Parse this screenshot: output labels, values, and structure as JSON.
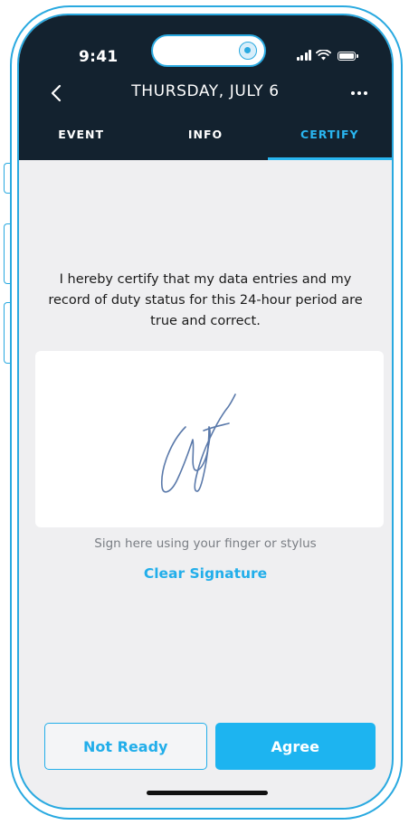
{
  "status_bar": {
    "time": "9:41"
  },
  "header": {
    "back_icon": "chevron-left-icon",
    "title": "THURSDAY, JULY 6",
    "more_icon": "ellipsis-icon"
  },
  "tabs": [
    {
      "label": "EVENT",
      "active": false
    },
    {
      "label": "INFO",
      "active": false
    },
    {
      "label": "CERTIFY",
      "active": true
    }
  ],
  "certify": {
    "statement": "I hereby certify that my data entries and my record of duty status for this 24-hour period are true and correct.",
    "signature_hint": "Sign here using your finger or stylus",
    "clear_label": "Clear Signature"
  },
  "actions": {
    "not_ready_label": "Not Ready",
    "agree_label": "Agree"
  },
  "colors": {
    "header_bg": "#13222f",
    "accent": "#1db4f0",
    "content_bg": "#efeff1",
    "signature_ink": "#5678a8"
  }
}
